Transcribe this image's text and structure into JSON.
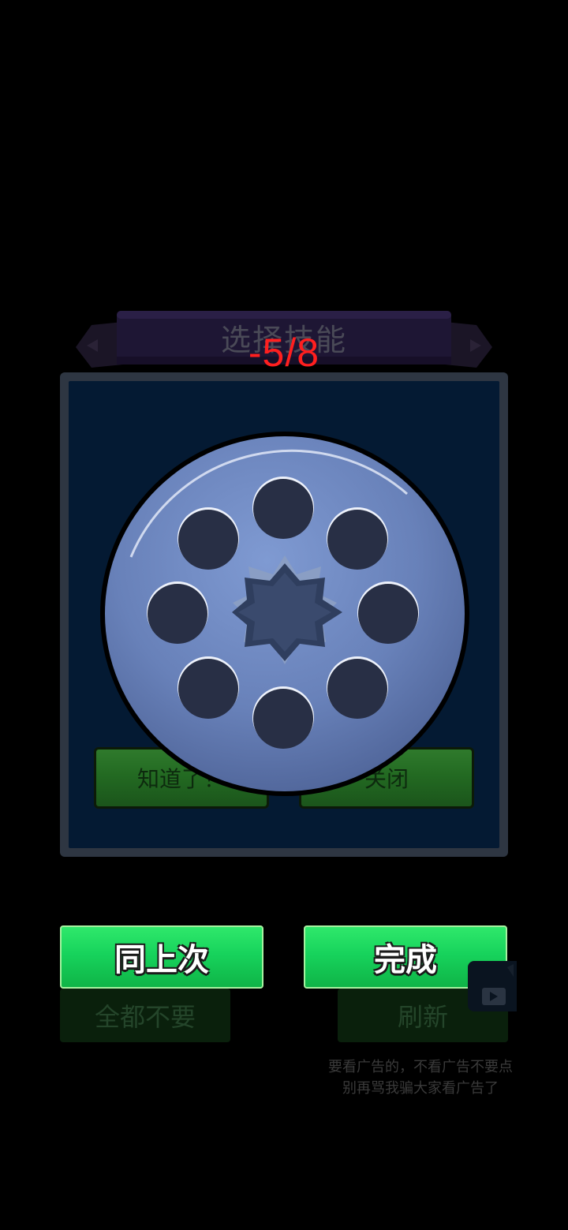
{
  "dialog": {
    "title": "选择技能",
    "counter": "-5/8",
    "got_it_label": "知道了！",
    "close_label": "关闭"
  },
  "actions": {
    "same_as_last_label": "同上次",
    "done_label": "完成",
    "none_label": "全都不要",
    "refresh_label": "刷新"
  },
  "notice": {
    "line1": "要看广告的，不看广告不要点",
    "line2": "别再骂我骗大家看广告了"
  },
  "wheel": {
    "slot_count": 8,
    "center_icon": "star-icon"
  },
  "icons": {
    "ad": "play-icon"
  },
  "colors": {
    "counter": "#ff1f1f",
    "button_green": "#17d35c",
    "panel_bg": "#041a33"
  }
}
